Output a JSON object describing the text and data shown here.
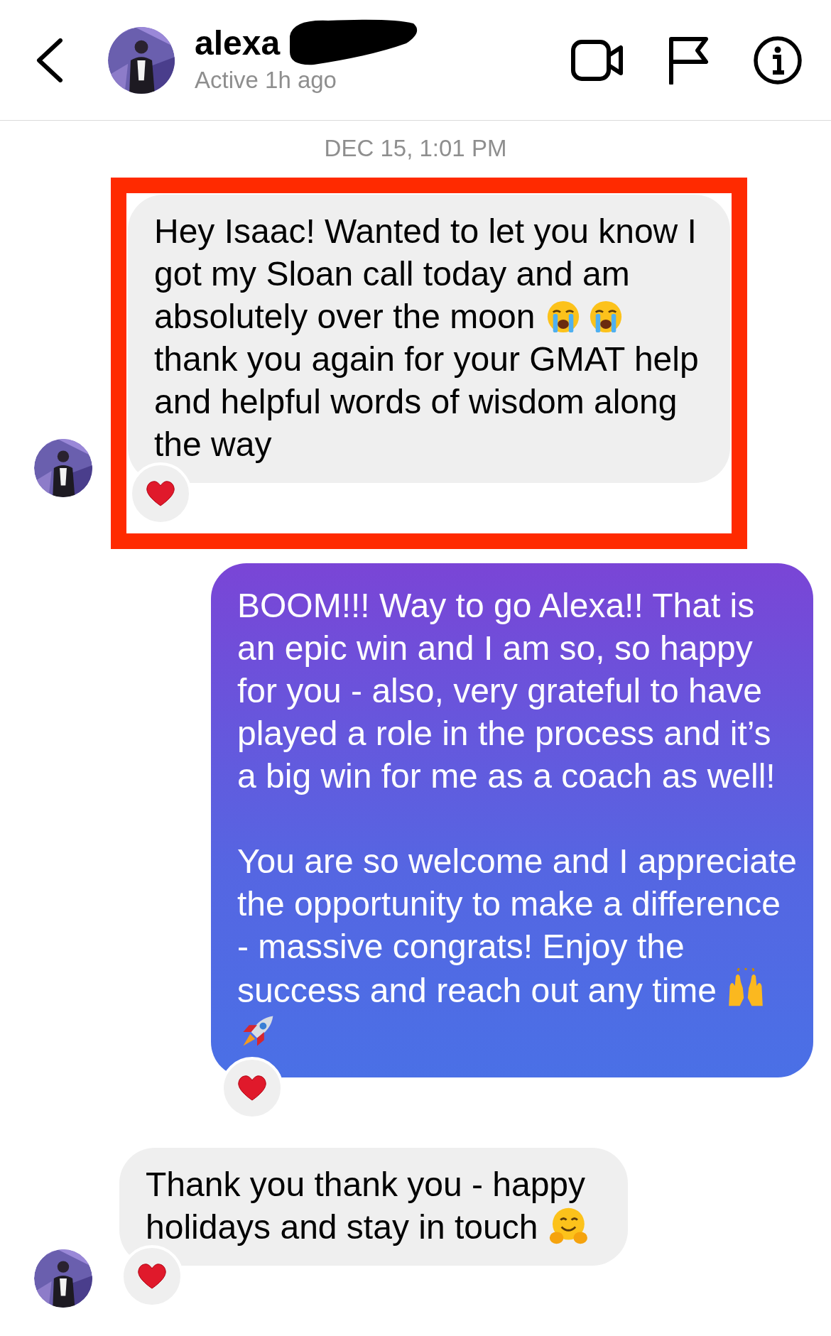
{
  "header": {
    "name": "alexa",
    "redacted": true,
    "status": "Active 1h ago"
  },
  "date": "DEC 15, 1:01 PM",
  "messages": [
    {
      "kind": "incoming",
      "highlighted": true,
      "reacted": true,
      "segments": [
        {
          "kind": "text",
          "text": "Hey Isaac! Wanted to let you know I got my Sloan call today and am absolutely over the moon "
        },
        {
          "kind": "crying"
        },
        {
          "kind": "crying"
        },
        {
          "kind": "text",
          "text": " thank you again for your GMAT help and helpful words of wisdom along the way"
        }
      ]
    },
    {
      "kind": "outgoing",
      "highlighted": false,
      "reacted": true,
      "segments": [
        {
          "kind": "text",
          "text": "BOOM!!! Way to go Alexa!! That is an epic win and I am so, so happy for you - also, very grateful to have played a role in the process and it’s a big win for me as a coach as well!\n\nYou are so welcome and I appreciate the opportunity to make a difference - massive congrats! Enjoy the success and reach out any time "
        },
        {
          "kind": "hands"
        },
        {
          "kind": "rocket"
        }
      ]
    },
    {
      "kind": "incoming",
      "highlighted": false,
      "reacted": true,
      "segments": [
        {
          "kind": "text",
          "text": "Thank you thank you - happy holidays and stay in touch "
        },
        {
          "kind": "hug"
        }
      ]
    }
  ]
}
